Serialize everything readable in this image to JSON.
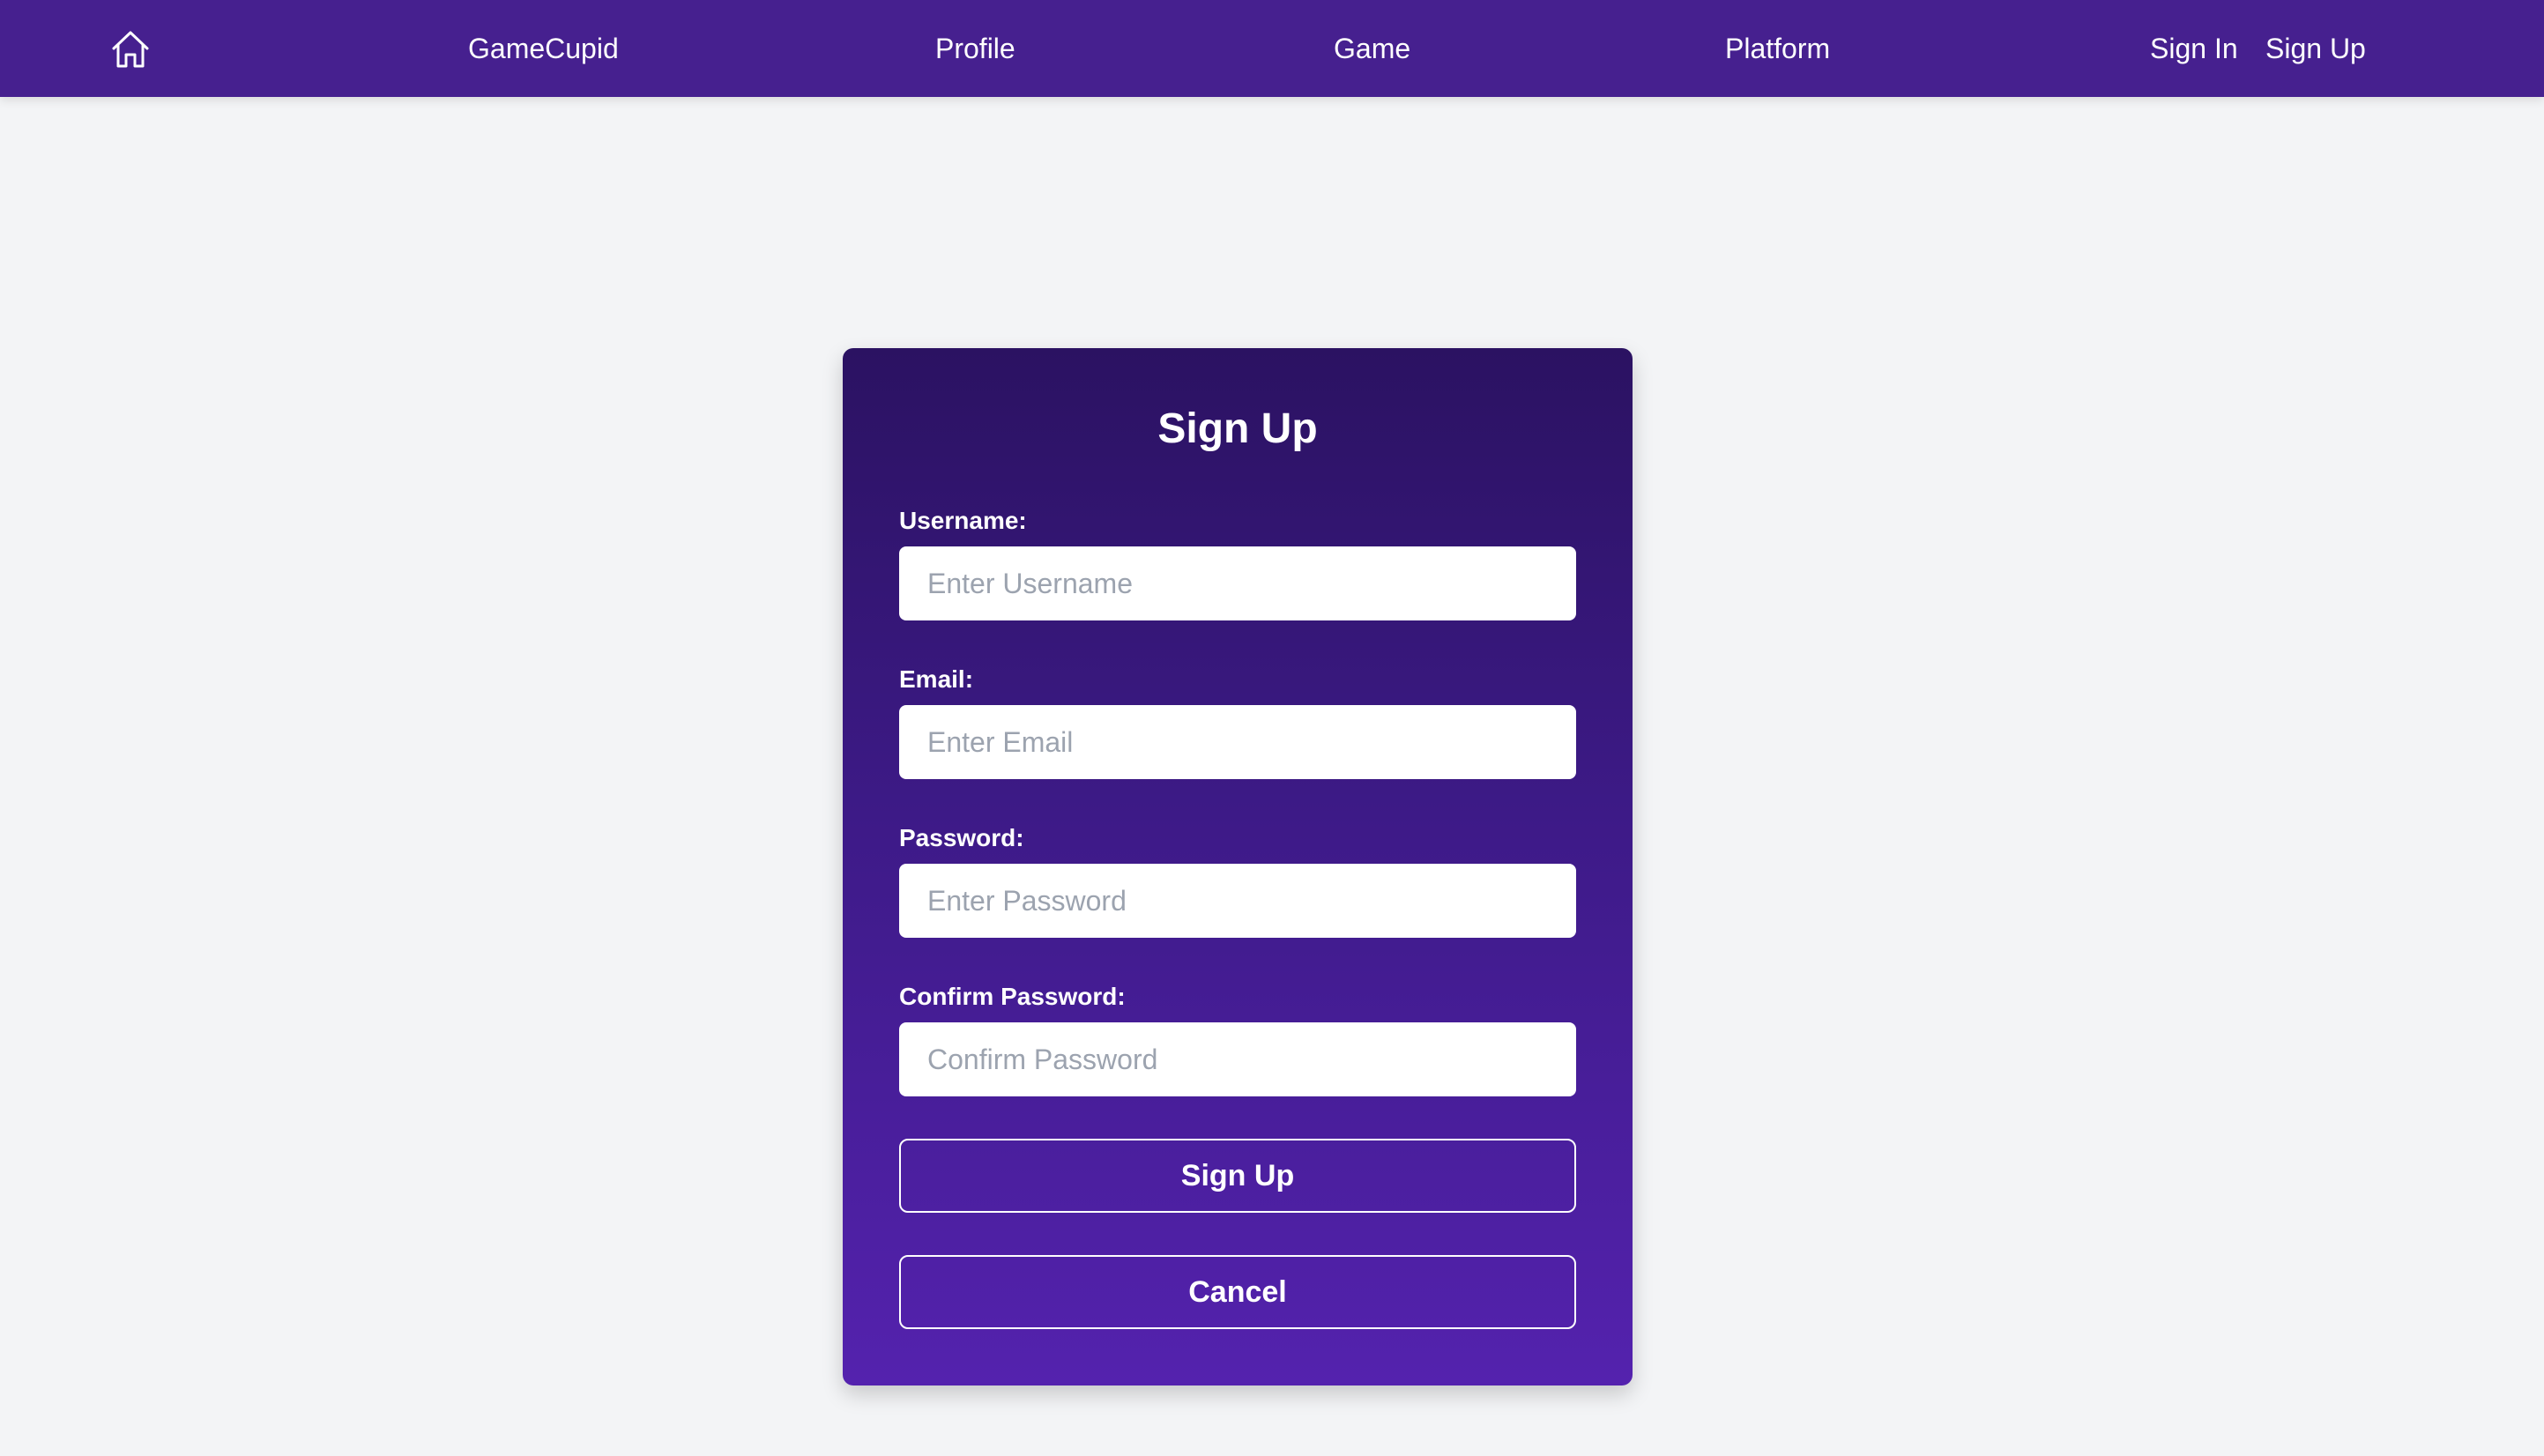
{
  "nav": {
    "home_icon": "home-icon",
    "brand": "GameCupid",
    "links": [
      "Profile",
      "Game",
      "Platform"
    ],
    "sign_in": "Sign In",
    "sign_up": "Sign Up"
  },
  "form": {
    "title": "Sign Up",
    "fields": [
      {
        "label": "Username:",
        "placeholder": "Enter Username",
        "value": ""
      },
      {
        "label": "Email:",
        "placeholder": "Enter Email",
        "value": ""
      },
      {
        "label": "Password:",
        "placeholder": "Enter Password",
        "value": ""
      },
      {
        "label": "Confirm Password:",
        "placeholder": "Confirm Password",
        "value": ""
      }
    ],
    "submit_label": "Sign Up",
    "cancel_label": "Cancel"
  },
  "colors": {
    "navbar": "#46208f",
    "card_top": "#2b1262",
    "card_bottom": "#5422ae",
    "page_background": "#f3f4f6"
  }
}
